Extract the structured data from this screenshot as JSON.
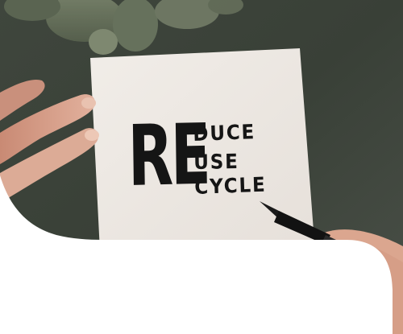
{
  "note": {
    "prefix": "RE",
    "words": [
      "DUCE",
      "USE",
      "CYCLE"
    ]
  },
  "colors": {
    "background": "#3b4239",
    "paper": "#ece8e3",
    "ink": "#151515",
    "skin": "#d9a28c",
    "overlay": "#ffffff"
  }
}
